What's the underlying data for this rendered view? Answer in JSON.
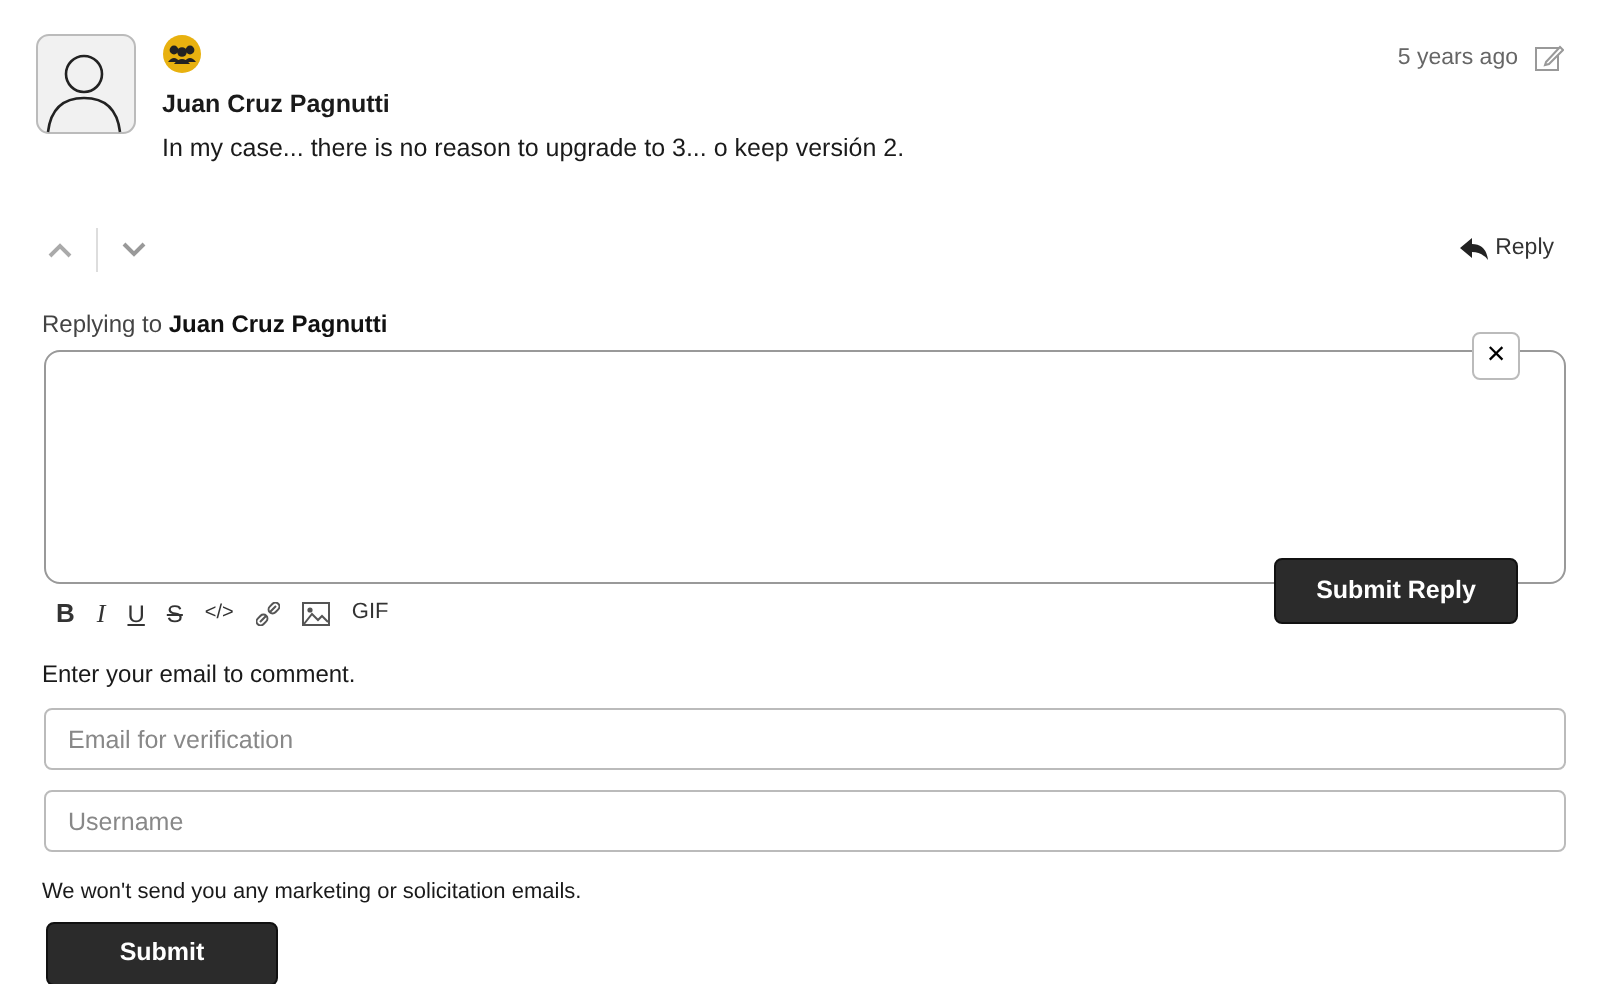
{
  "comment": {
    "author": "Juan Cruz Pagnutti",
    "time": "5 years ago",
    "text": "In my case... there is no reason to upgrade to 3... o keep versión 2."
  },
  "reply_button": "Reply",
  "reply_form": {
    "prefix": "Replying to",
    "name": "Juan Cruz Pagnutti",
    "close": "×",
    "submit": "Submit Reply",
    "toolbar": [
      {
        "kind": "bold",
        "label": "B"
      },
      {
        "kind": "italic",
        "label": "I"
      },
      {
        "kind": "underline",
        "label": "U"
      },
      {
        "kind": "strike",
        "label": "S"
      },
      {
        "kind": "code",
        "label": "</>"
      },
      {
        "kind": "link"
      },
      {
        "kind": "image"
      },
      {
        "kind": "gif",
        "label": "GIF"
      }
    ]
  },
  "email_prompt": "Enter your email to comment.",
  "fields": [
    {
      "placeholder": "Email for verification"
    },
    {
      "placeholder": "Username"
    }
  ],
  "notice": "We won't send you any marketing or solicitation emails.",
  "submit": "Submit"
}
